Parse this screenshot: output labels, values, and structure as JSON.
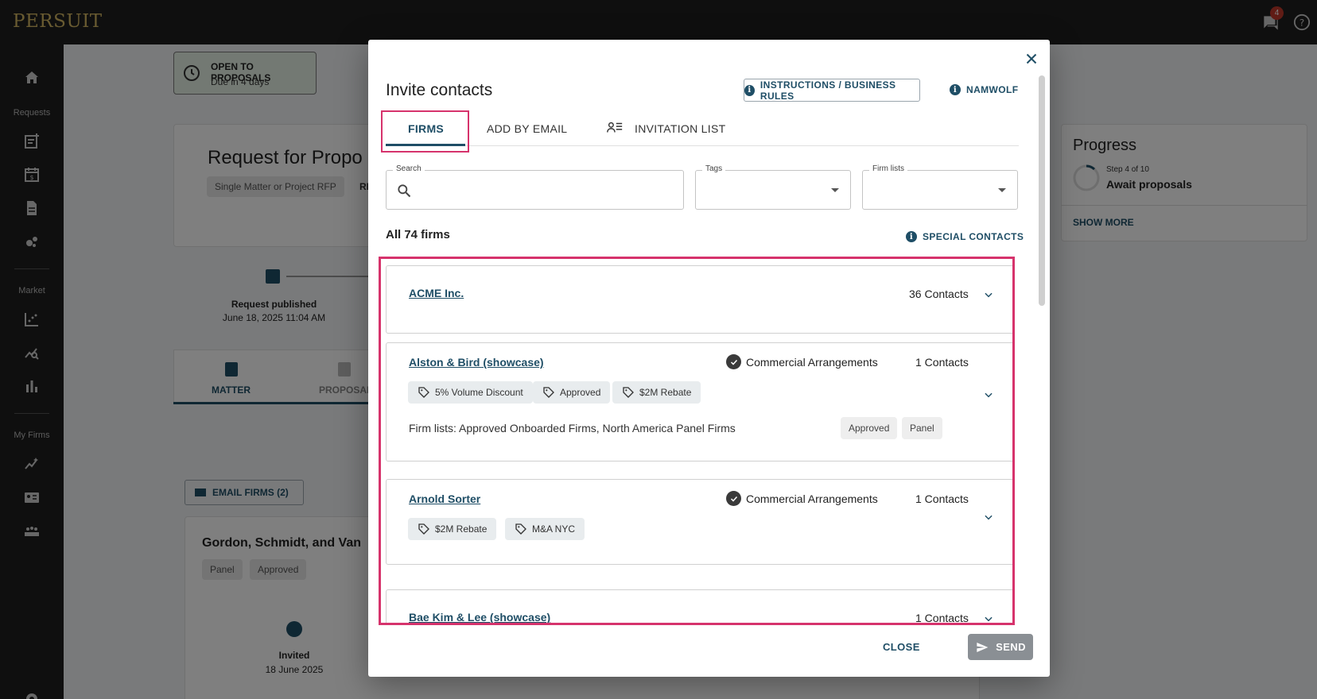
{
  "app": {
    "logo": "PERSUIT",
    "notification_count": "4"
  },
  "sidebar": {
    "requests_label": "Requests",
    "market_label": "Market",
    "myfirms_label": "My Firms"
  },
  "background": {
    "status_title": "OPEN TO PROPOSALS",
    "status_sub": "Due in 4 days",
    "rfp_title": "Request for Propo",
    "rfp_chip": "Single Matter or Project RFP",
    "rfp_chip2": "RI",
    "published_label": "Request published",
    "published_date": "June 18, 2025 11:04 AM",
    "tab_matter": "MATTER",
    "tab_proposal": "PROPOSAL",
    "email_firms": "EMAIL FIRMS (2)",
    "firm_card_title": "Gordon, Schmidt, and Van",
    "firm_chip_panel": "Panel",
    "firm_chip_approved": "Approved",
    "invited_label": "Invited",
    "invited_date": "18 June 2025",
    "progress_title": "Progress",
    "progress_step": "Step 4 of 10",
    "progress_status": "Await proposals",
    "show_more": "SHOW MORE"
  },
  "modal": {
    "title": "Invite contacts",
    "instructions_btn": "INSTRUCTIONS / BUSINESS RULES",
    "namwolf_btn": "NAMWOLF",
    "tabs": [
      "FIRMS",
      "ADD BY EMAIL",
      "INVITATION LIST"
    ],
    "search_label": "Search",
    "search_placeholder": "",
    "tags_label": "Tags",
    "firm_lists_label": "Firm lists",
    "all_firms": "All 74 firms",
    "special_contacts": "SPECIAL CONTACTS",
    "firms": [
      {
        "name": "ACME Inc.",
        "contacts": "36 Contacts"
      },
      {
        "name": "Alston & Bird (showcase)",
        "commercial": "Commercial Arrangements",
        "contacts": "1 Contacts",
        "tags": [
          "5% Volume Discount",
          "Approved",
          "$2M Rebate"
        ],
        "firm_lists": "Firm lists: Approved Onboarded Firms, North America Panel Firms",
        "list_chips": [
          "Approved",
          "Panel"
        ]
      },
      {
        "name": "Arnold Sorter",
        "commercial": "Commercial Arrangements",
        "contacts": "1 Contacts",
        "tags": [
          "$2M Rebate",
          "M&A NYC"
        ]
      },
      {
        "name": "Bae Kim & Lee (showcase)",
        "contacts": "1 Contacts"
      }
    ],
    "close_btn": "CLOSE",
    "send_btn": "SEND"
  },
  "colors": {
    "accent": "#1f4e66",
    "highlight": "#d6336c",
    "logo": "#d2b663"
  }
}
